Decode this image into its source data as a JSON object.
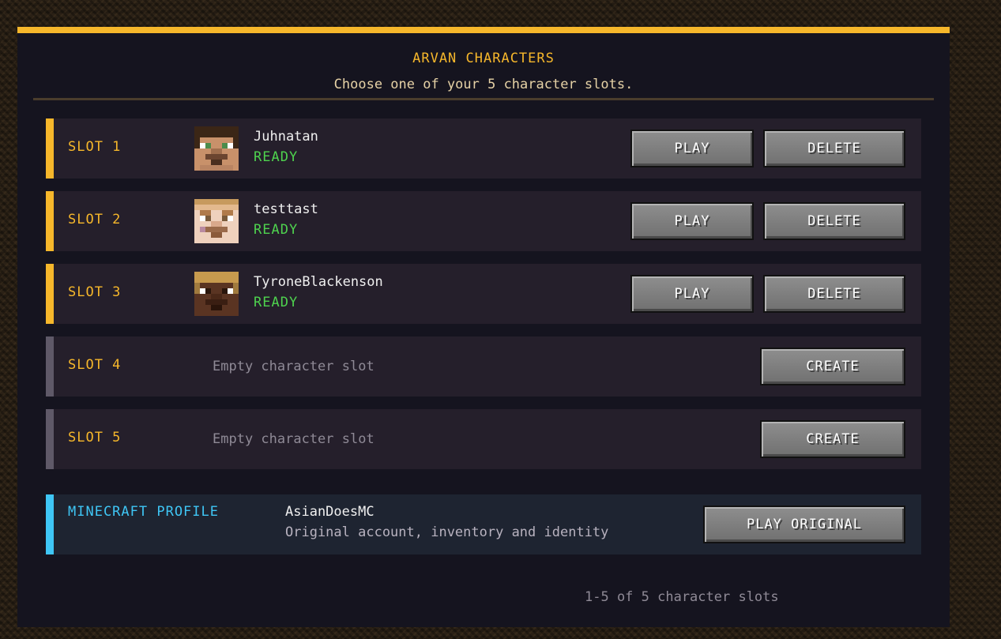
{
  "header": {
    "title": "ARVAN CHARACTERS",
    "subtitle": "Choose one of your 5 character slots."
  },
  "slots": [
    {
      "label": "SLOT 1",
      "name": "Juhnatan",
      "status": "READY",
      "play_label": "PLAY",
      "delete_label": "DELETE"
    },
    {
      "label": "SLOT 2",
      "name": "testtast",
      "status": "READY",
      "play_label": "PLAY",
      "delete_label": "DELETE"
    },
    {
      "label": "SLOT 3",
      "name": "TyroneBlackenson",
      "status": "READY",
      "play_label": "PLAY",
      "delete_label": "DELETE"
    },
    {
      "label": "SLOT 4",
      "empty_text": "Empty character slot",
      "create_label": "CREATE"
    },
    {
      "label": "SLOT 5",
      "empty_text": "Empty character slot",
      "create_label": "CREATE"
    }
  ],
  "profile": {
    "label": "MINECRAFT PROFILE",
    "name": "AsianDoesMC",
    "description": "Original account, inventory and identity",
    "button_label": "PLAY ORIGINAL"
  },
  "footer": {
    "count_text": "1-5 of 5 character slots"
  },
  "colors": {
    "accent": "#f6b72b",
    "ready": "#4ed24e",
    "profile_accent": "#3fc6f5",
    "panel_bg": "#15141f"
  }
}
